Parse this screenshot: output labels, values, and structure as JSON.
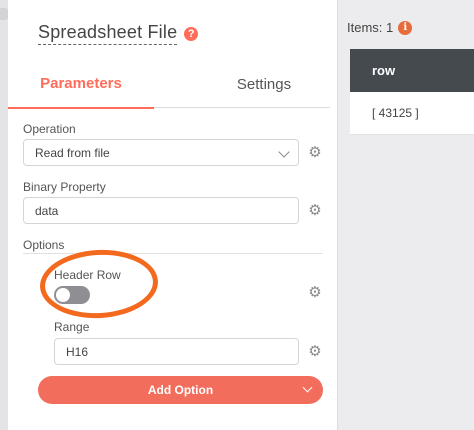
{
  "node": {
    "title": "Spreadsheet File",
    "help_glyph": "?"
  },
  "tabs": [
    {
      "label": "Parameters",
      "active": true
    },
    {
      "label": "Settings",
      "active": false
    }
  ],
  "fields": {
    "operation": {
      "label": "Operation",
      "value": "Read from file"
    },
    "binary_property": {
      "label": "Binary Property",
      "value": "data"
    }
  },
  "options": {
    "label": "Options",
    "header_row": {
      "label": "Header Row",
      "enabled": false
    },
    "range": {
      "label": "Range",
      "value": "H16"
    },
    "add_option_label": "Add Option"
  },
  "output": {
    "items_label": "Items: 1",
    "info_glyph": "i",
    "column_header": "row",
    "rows": [
      "[ 43125 ]"
    ]
  },
  "colors": {
    "accent": "#ff6d5a",
    "annotation_circle": "#f36a1e",
    "table_header": "#454a4f"
  },
  "icons": {
    "gear": "⚙",
    "chevron": "chevron-down-icon"
  }
}
